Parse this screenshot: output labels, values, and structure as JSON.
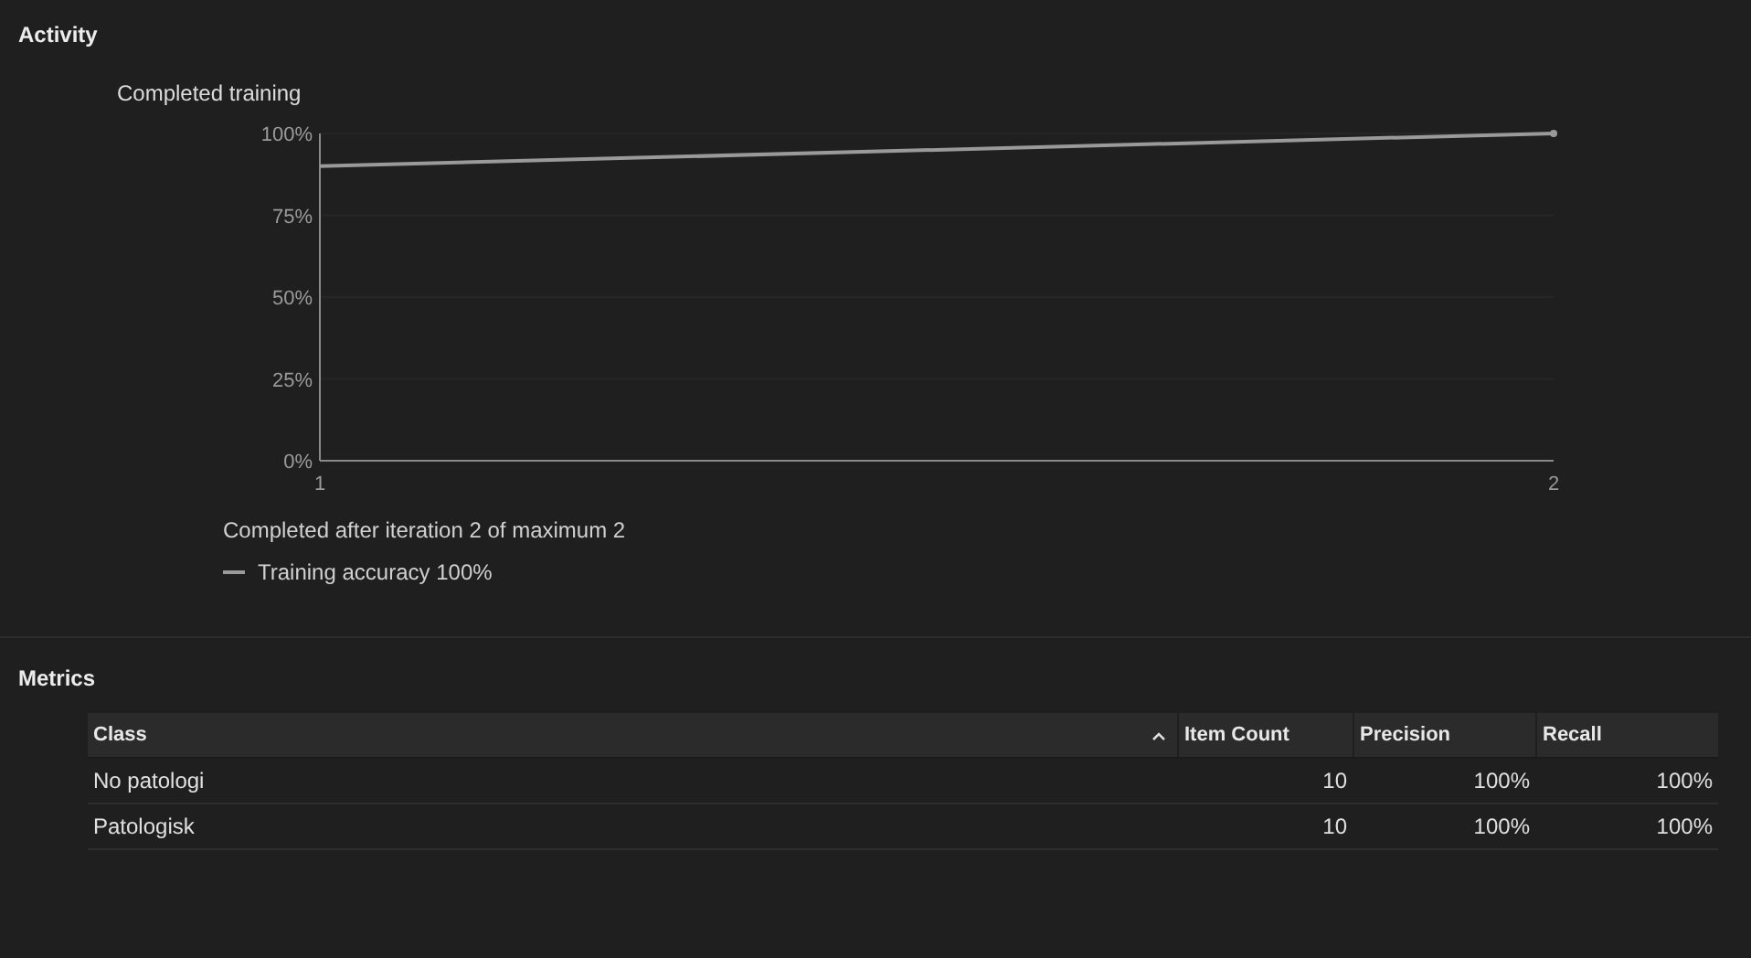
{
  "activity": {
    "title": "Activity",
    "chart_title": "Completed training",
    "chart_data": {
      "type": "line",
      "x": [
        1,
        2
      ],
      "series": [
        {
          "name": "Training accuracy",
          "color": "#9a9a9a",
          "values": [
            90,
            100
          ]
        }
      ],
      "ylim": [
        0,
        100
      ],
      "yticks": [
        {
          "value": 0,
          "label": "0%"
        },
        {
          "value": 25,
          "label": "25%"
        },
        {
          "value": 50,
          "label": "50%"
        },
        {
          "value": 75,
          "label": "75%"
        },
        {
          "value": 100,
          "label": "100%"
        }
      ],
      "xticks": [
        1,
        2
      ],
      "xlim": [
        1,
        2
      ],
      "grid": true
    },
    "status": "Completed after iteration 2 of maximum 2",
    "legend_value": "100%"
  },
  "metrics": {
    "title": "Metrics",
    "columns": [
      {
        "label": "Class",
        "sorted": true
      },
      {
        "label": "Item Count",
        "sorted": false
      },
      {
        "label": "Precision",
        "sorted": false
      },
      {
        "label": "Recall",
        "sorted": false
      }
    ],
    "rows": [
      [
        "No patologi",
        "10",
        "100%",
        "100%"
      ],
      [
        "Patologisk",
        "10",
        "100%",
        "100%"
      ]
    ]
  }
}
